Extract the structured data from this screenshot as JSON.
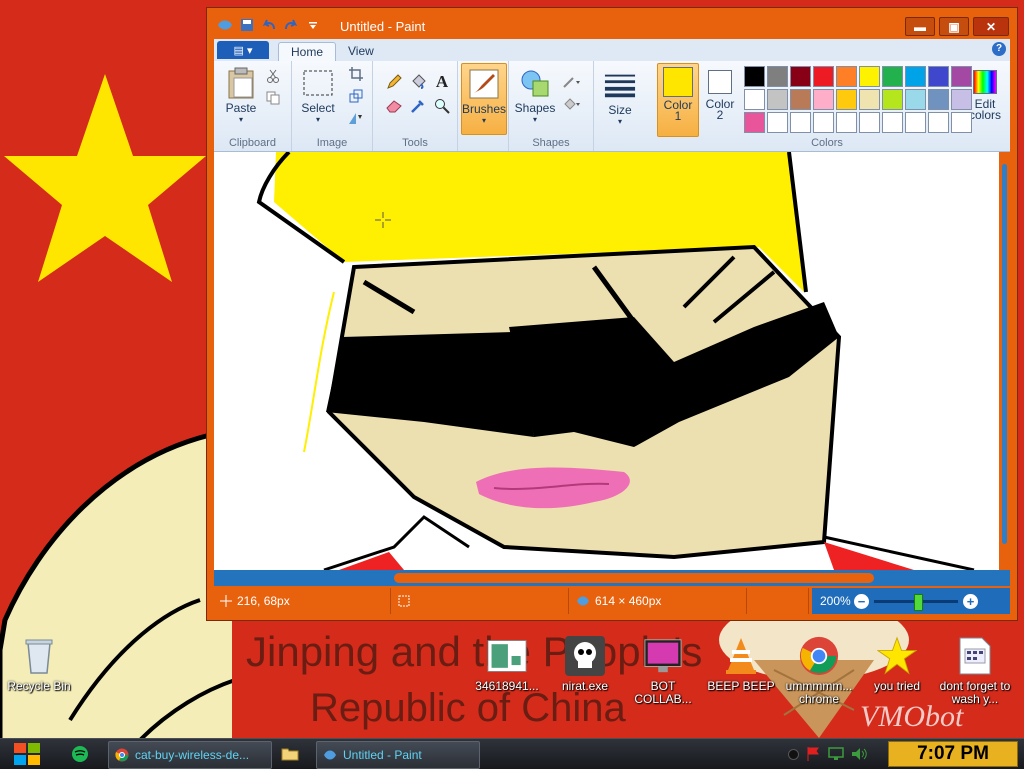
{
  "window": {
    "title": "Untitled - Paint",
    "controls": {
      "minimize": "▬",
      "maximize": "▣",
      "close": "✕"
    }
  },
  "ribbon": {
    "file_menu": "▤ ▾",
    "tabs": [
      "Home",
      "View"
    ],
    "help": "?",
    "groups": {
      "clipboard": {
        "label": "Clipboard",
        "paste": "Paste"
      },
      "image": {
        "label": "Image",
        "select": "Select"
      },
      "tools": {
        "label": "Tools"
      },
      "brushes": {
        "label": "Brushes"
      },
      "shapes": {
        "label": "Shapes",
        "button": "Shapes"
      },
      "size": {
        "label": "Size"
      },
      "colors": {
        "label": "Colors",
        "color1_line1": "Color",
        "color1_line2": "1",
        "color2_line1": "Color",
        "color2_line2": "2",
        "edit_line1": "Edit",
        "edit_line2": "colors",
        "color1_value": "#ffe600",
        "color2_value": "#ffffff",
        "palette": [
          "#000000",
          "#7f7f7f",
          "#880015",
          "#ed1c24",
          "#ff7f27",
          "#fff200",
          "#22b14c",
          "#00a2e8",
          "#3f48cc",
          "#a349a4",
          "#ffffff",
          "#c3c3c3",
          "#b97a57",
          "#ffaec9",
          "#ffc90e",
          "#efe4b0",
          "#b5e61d",
          "#99d9ea",
          "#7092be",
          "#c8bfe7",
          "#e8559b",
          "#ffffff",
          "#ffffff",
          "#ffffff",
          "#ffffff",
          "#ffffff",
          "#ffffff",
          "#ffffff",
          "#ffffff",
          "#ffffff"
        ]
      }
    }
  },
  "status": {
    "cursor_pos": "216, 68px",
    "selection_size": "",
    "image_size": "614 × 460px",
    "zoom": "200%"
  },
  "desktop": {
    "wallpaper_text_line1": "Jinping and the People's",
    "wallpaper_text_line2": "Republic of China",
    "signature": "VMObot",
    "icons": [
      {
        "label": "Recycle Bin"
      },
      {
        "label": "34618941..."
      },
      {
        "label": "nirat.exe"
      },
      {
        "label": "BOT COLLAB..."
      },
      {
        "label": "BEEP BEEP"
      },
      {
        "label": "ummmmm... chrome"
      },
      {
        "label": "you tried"
      },
      {
        "label": "dont forget to wash y..."
      }
    ]
  },
  "taskbar": {
    "tasks": [
      {
        "label": "cat-buy-wireless-de..."
      },
      {
        "label": "Untitled - Paint"
      }
    ],
    "clock": "7:07 PM"
  },
  "colors": {
    "accent": "#e8620e",
    "zoom_bar": "#1f6dba",
    "wallpaper_red": "#d42b1b",
    "star_yellow": "#ffe600"
  }
}
